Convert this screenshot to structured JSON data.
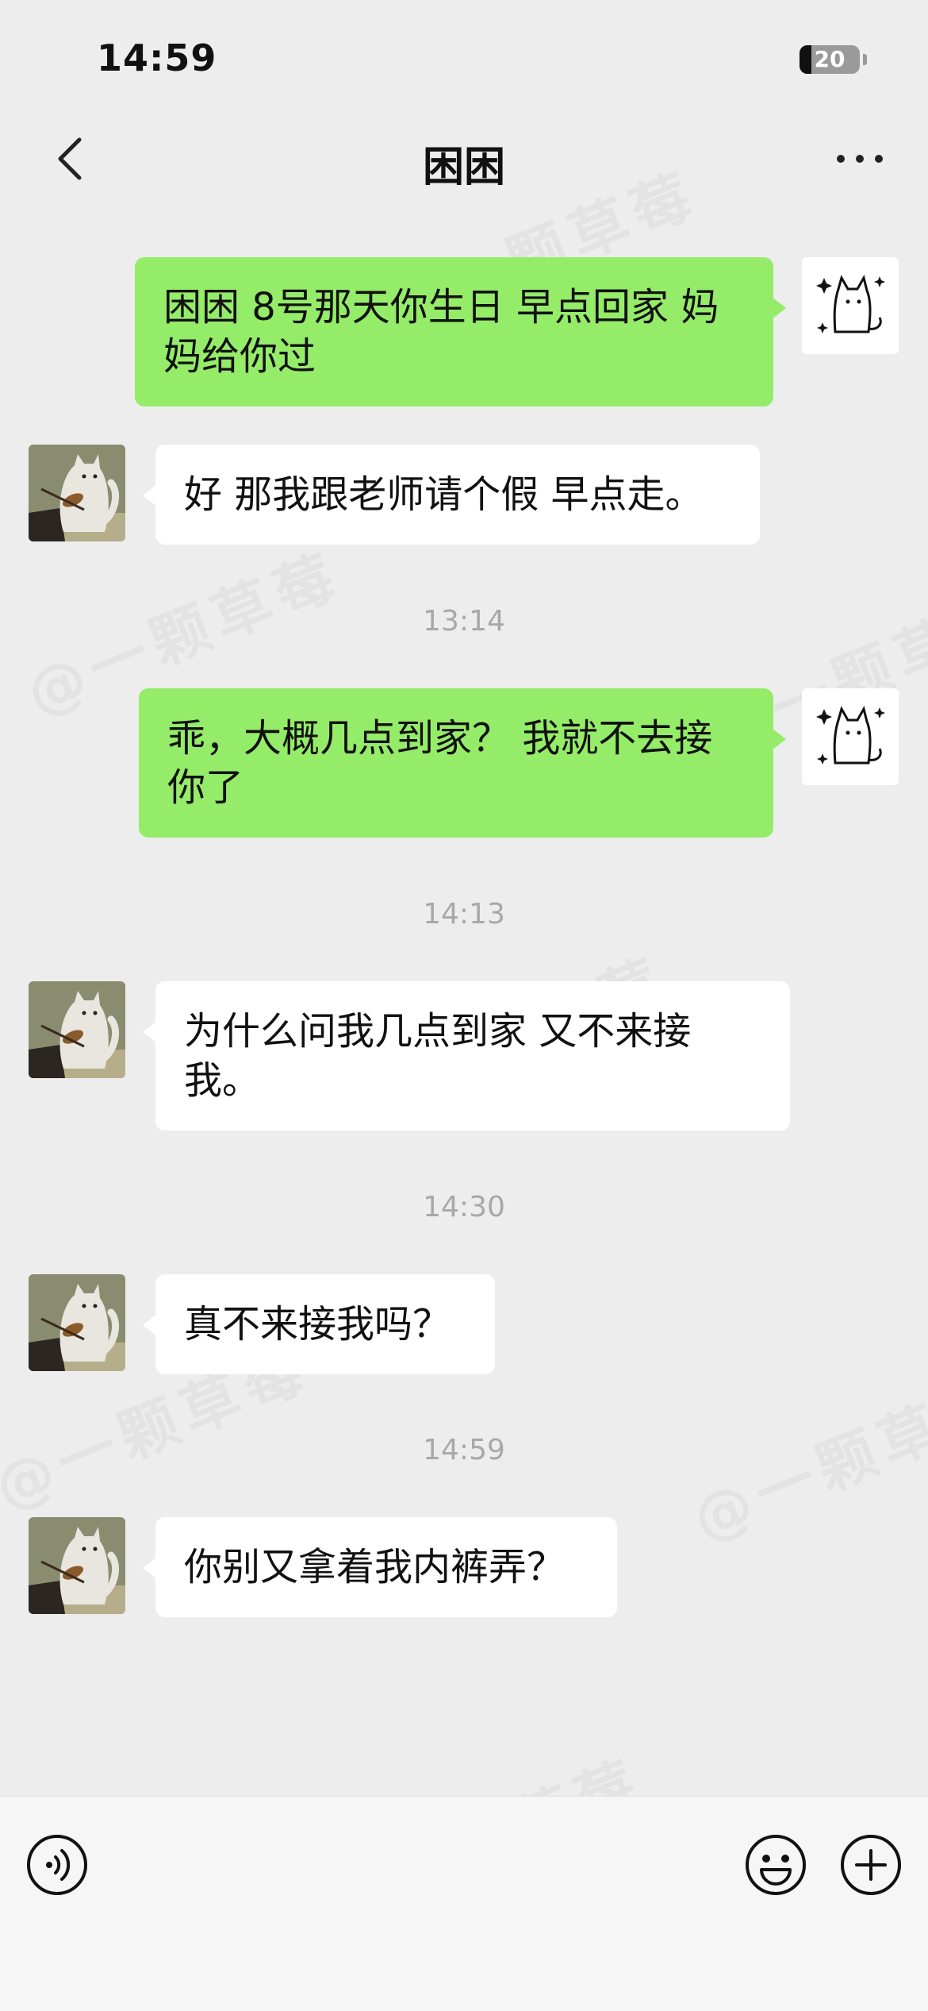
{
  "status_bar": {
    "time": "14:59",
    "battery_level": "20",
    "battery_fraction": 0.2
  },
  "header": {
    "title": "困困",
    "back_icon": "chevron-left-icon",
    "more_icon": "ellipsis-icon"
  },
  "watermark_text": "@一颗草莓",
  "messages": [
    {
      "type": "message",
      "side": "outgoing",
      "text": "困困 8号那天你生日 早点回家 妈妈给你过"
    },
    {
      "type": "message",
      "side": "incoming",
      "text": "好 那我跟老师请个假 早点走。"
    },
    {
      "type": "timestamp",
      "text": "13:14"
    },
    {
      "type": "message",
      "side": "outgoing",
      "text": "乖，大概几点到家？ 我就不去接你了"
    },
    {
      "type": "timestamp",
      "text": "14:13"
    },
    {
      "type": "message",
      "side": "incoming",
      "text": "为什么问我几点到家 又不来接我。"
    },
    {
      "type": "timestamp",
      "text": "14:30"
    },
    {
      "type": "message",
      "side": "incoming",
      "text": "真不来接我吗？"
    },
    {
      "type": "timestamp",
      "text": "14:59"
    },
    {
      "type": "message",
      "side": "incoming",
      "text": "你别又拿着我内裤弄？"
    }
  ],
  "input_bar": {
    "placeholder": "",
    "voice_icon": "voice-icon",
    "emoji_icon": "emoji-icon",
    "plus_icon": "plus-icon"
  }
}
